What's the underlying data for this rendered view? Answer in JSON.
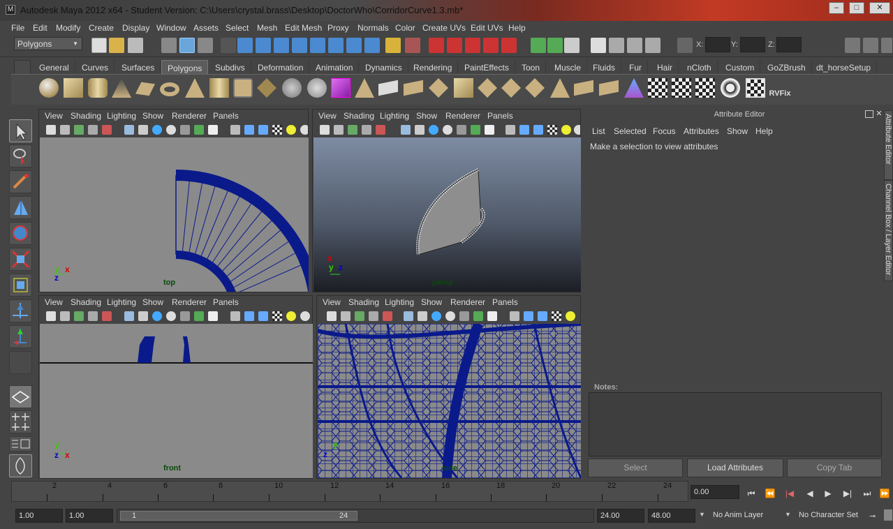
{
  "window": {
    "title": "Autodesk Maya 2012 x64 - Student Version: C:\\Users\\crystal.brass\\Desktop\\DoctorWho\\CorridorCurve1.3.mb*",
    "controls": [
      "–",
      "□",
      "✕"
    ]
  },
  "menubar": [
    "File",
    "Edit",
    "Modify",
    "Create",
    "Display",
    "Window",
    "Assets",
    "Select",
    "Mesh",
    "Edit Mesh",
    "Proxy",
    "Normals",
    "Color",
    "Create UVs",
    "Edit UVs",
    "Help"
  ],
  "statusline": {
    "mode": "Polygons",
    "coords": {
      "x": "X:",
      "y": "Y:",
      "z": "Z:"
    }
  },
  "shelf": {
    "tabs": [
      "General",
      "Curves",
      "Surfaces",
      "Polygons",
      "Subdivs",
      "Deformation",
      "Animation",
      "Dynamics",
      "Rendering",
      "PaintEffects",
      "Toon",
      "Muscle",
      "Fluids",
      "Fur",
      "Hair",
      "nCloth",
      "Custom",
      "GoZBrush",
      "dt_horseSetup"
    ],
    "active_tab": "Polygons",
    "rvfix_label": "RVFix"
  },
  "viewport_menu": [
    "View",
    "Shading",
    "Lighting",
    "Show",
    "Renderer",
    "Panels"
  ],
  "viewports": {
    "top": {
      "camera": "top"
    },
    "persp": {
      "camera": "persp"
    },
    "front": {
      "camera": "front"
    },
    "side": {
      "camera": "side"
    }
  },
  "attribute_editor": {
    "title": "Attribute Editor",
    "menu": [
      "List",
      "Selected",
      "Focus",
      "Attributes",
      "Show",
      "Help"
    ],
    "message": "Make a selection to view attributes",
    "notes_label": "Notes:",
    "buttons": {
      "select": "Select",
      "load": "Load Attributes",
      "copy": "Copy Tab"
    },
    "side_tabs": {
      "attribute": "Attribute Editor",
      "channel": "Channel Box / Layer Editor"
    }
  },
  "timeline": {
    "ticks": [
      "2",
      "4",
      "6",
      "8",
      "10",
      "12",
      "14",
      "16",
      "18",
      "20",
      "22",
      "24"
    ],
    "current_time": "0.00"
  },
  "range": {
    "start": "1.00",
    "playback_start": "1.00",
    "slider_start": "1",
    "slider_end": "24",
    "playback_end": "24.00",
    "end": "48.00",
    "anim_layer": "No Anim Layer",
    "char_set": "No Character Set"
  },
  "playback": [
    "⏮",
    "⏪",
    "|◀",
    "◀",
    "▶",
    "▶|",
    "⏭",
    "⏩"
  ],
  "colors": {
    "wire": "#0a1a8a",
    "viewport_bg": "#8a8a8a",
    "ui_bg": "#444444"
  }
}
